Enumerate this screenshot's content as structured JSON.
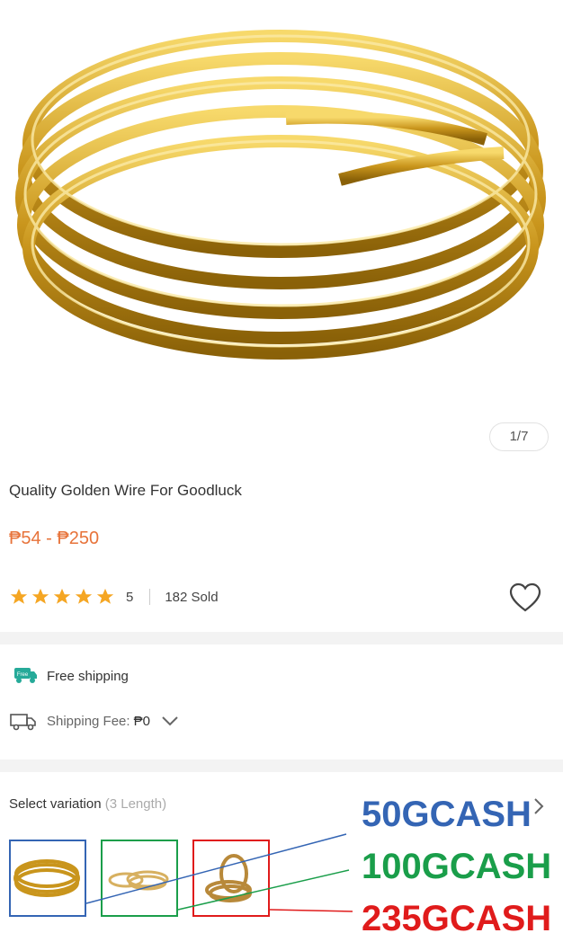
{
  "gallery": {
    "counter": "1/7"
  },
  "product": {
    "title": "Quality Golden Wire For Goodluck",
    "price_range": "₱54 - ₱250",
    "rating": "5",
    "rating_stars": 5,
    "sold": "182 Sold"
  },
  "shipping": {
    "free_label": "Free shipping",
    "free_badge": "Free",
    "fee_label": "Shipping Fee:",
    "fee_value": "₱0"
  },
  "variation": {
    "label": "Select variation",
    "count": "(3 Length)",
    "options": [
      {
        "price_tag": "50GCASH",
        "color": "#3465b4"
      },
      {
        "price_tag": "100GCASH",
        "color": "#1a9e4a"
      },
      {
        "price_tag": "235GCASH",
        "color": "#e01b1b"
      }
    ]
  },
  "colors": {
    "accent_price": "#e7733a",
    "star": "#f5a623",
    "free_ship": "#26aa99"
  }
}
